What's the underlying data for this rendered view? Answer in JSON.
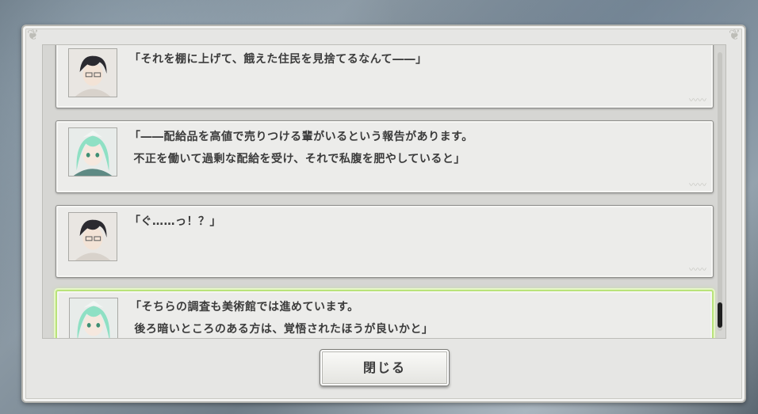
{
  "dialogue_log": {
    "entries": [
      {
        "speaker_icon": "dark-haired-man-portrait",
        "text": "「それを棚に上げて、餓えた住民を見捨てるなんて――」"
      },
      {
        "speaker_icon": "green-haired-girl-portrait",
        "text": "「――配給品を高値で売りつける輩がいるという報告があります。\n 不正を働いて過剰な配給を受け、それで私腹を肥やしていると」"
      },
      {
        "speaker_icon": "dark-haired-man-portrait",
        "text": "「ぐ……っ！？」"
      },
      {
        "speaker_icon": "green-haired-girl-portrait",
        "text": "「そちらの調査も美術館では進めています。\n 後ろ暗いところのある方は、覚悟されたほうが良いかと」"
      }
    ]
  },
  "close_button": {
    "label": "閉じる"
  },
  "colors": {
    "highlight": "#b9e37a",
    "panel": "#e6e6e4",
    "text": "#3b3b3b"
  }
}
